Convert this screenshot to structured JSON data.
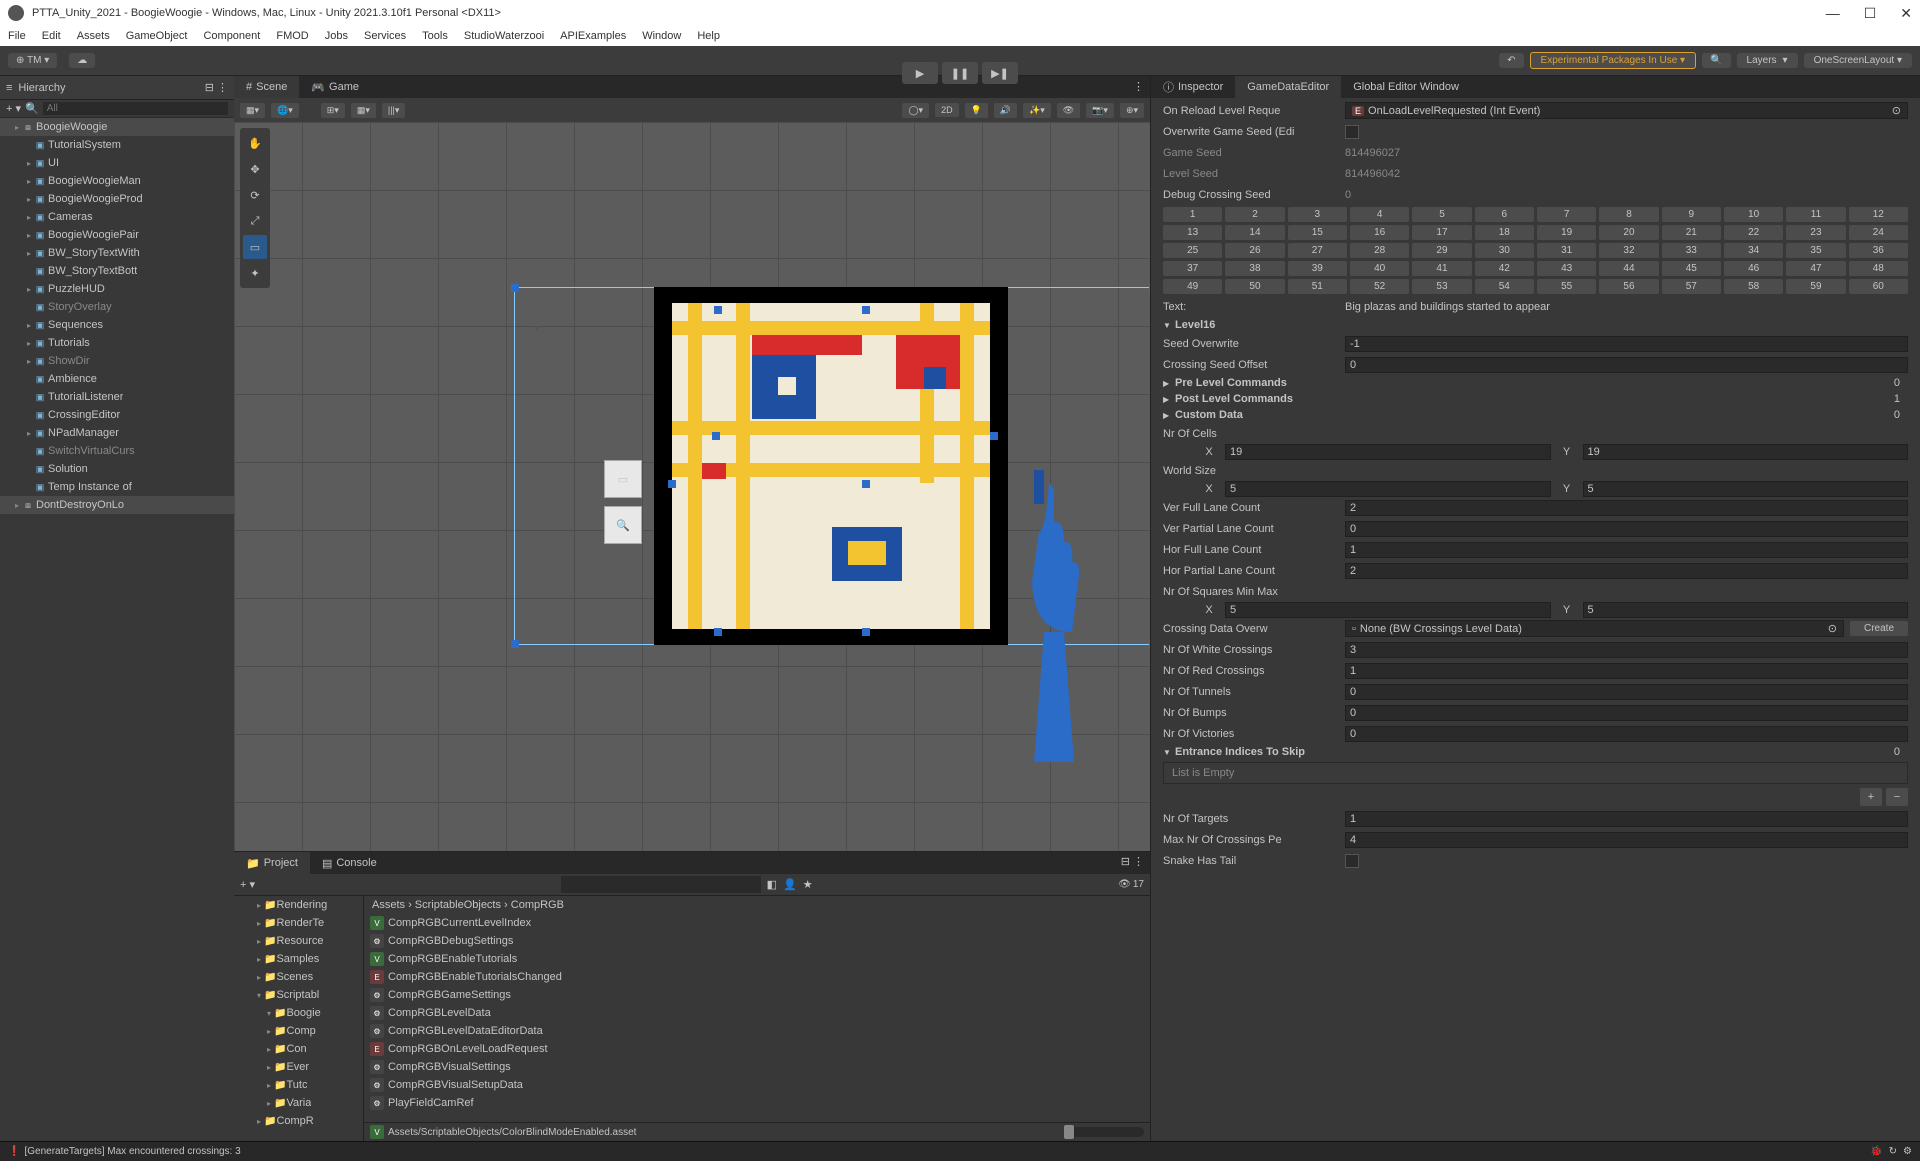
{
  "titlebar": "PTTA_Unity_2021 - BoogieWoogie - Windows, Mac, Linux - Unity 2021.3.10f1 Personal <DX11>",
  "menu": [
    "File",
    "Edit",
    "Assets",
    "GameObject",
    "Component",
    "FMOD",
    "Jobs",
    "Services",
    "Tools",
    "StudioWaterzooi",
    "APIExamples",
    "Window",
    "Help"
  ],
  "toolbar": {
    "tm": "TM ▾",
    "warn": "Experimental Packages In Use ▾",
    "layers": "Layers",
    "layout": "OneScreenLayout ▾"
  },
  "hierarchy": {
    "title": "Hierarchy",
    "search_ph": "All",
    "root": "BoogieWoogie",
    "items": [
      {
        "label": "TutorialSystem",
        "indent": 2,
        "dim": false
      },
      {
        "label": "UI",
        "indent": 2,
        "dim": false,
        "exp": true
      },
      {
        "label": "BoogieWoogieMan",
        "indent": 2,
        "dim": false,
        "exp": true
      },
      {
        "label": "BoogieWoogieProd",
        "indent": 2,
        "dim": false,
        "exp": true
      },
      {
        "label": "Cameras",
        "indent": 2,
        "dim": false,
        "exp": true
      },
      {
        "label": "BoogieWoogiePair",
        "indent": 2,
        "dim": false,
        "exp": true
      },
      {
        "label": "BW_StoryTextWith",
        "indent": 2,
        "dim": false,
        "exp": true
      },
      {
        "label": "BW_StoryTextBott",
        "indent": 2,
        "dim": false
      },
      {
        "label": "PuzzleHUD",
        "indent": 2,
        "dim": false,
        "exp": true
      },
      {
        "label": "StoryOverlay",
        "indent": 2,
        "dim": true
      },
      {
        "label": "Sequences",
        "indent": 2,
        "dim": false,
        "exp": true
      },
      {
        "label": "Tutorials",
        "indent": 2,
        "dim": false,
        "exp": true
      },
      {
        "label": "ShowDir",
        "indent": 2,
        "dim": true,
        "exp": true
      },
      {
        "label": "Ambience",
        "indent": 2,
        "dim": false
      },
      {
        "label": "TutorialListener",
        "indent": 2,
        "dim": false
      },
      {
        "label": "CrossingEditor",
        "indent": 2,
        "dim": false
      },
      {
        "label": "NPadManager",
        "indent": 2,
        "dim": false,
        "exp": true
      },
      {
        "label": "SwitchVirtualCurs",
        "indent": 2,
        "dim": true
      },
      {
        "label": "Solution",
        "indent": 2,
        "dim": false
      },
      {
        "label": "Temp Instance of",
        "indent": 2,
        "dim": false
      }
    ],
    "dontdestroy": "DontDestroyOnLo"
  },
  "scene": {
    "tab_scene": "Scene",
    "tab_game": "Game",
    "btn_2d": "2D"
  },
  "project": {
    "tab_project": "Project",
    "tab_console": "Console",
    "breadcrumb": "Assets  ›  ScriptableObjects  ›  CompRGB",
    "tree": [
      "Rendering",
      "RenderTe",
      "Resource",
      "Samples",
      "Scenes",
      "Scriptabl",
      "Boogie",
      "Comp",
      "Con",
      "Ever",
      "Tutc",
      "Varia",
      "CompR"
    ],
    "assets": [
      {
        "t": "v",
        "label": "CompRGBCurrentLevelIndex"
      },
      {
        "t": "s",
        "label": "CompRGBDebugSettings"
      },
      {
        "t": "v",
        "label": "CompRGBEnableTutorials"
      },
      {
        "t": "e",
        "label": "CompRGBEnableTutorialsChanged"
      },
      {
        "t": "s",
        "label": "CompRGBGameSettings"
      },
      {
        "t": "s",
        "label": "CompRGBLevelData"
      },
      {
        "t": "s",
        "label": "CompRGBLevelDataEditorData"
      },
      {
        "t": "e",
        "label": "CompRGBOnLevelLoadRequest"
      },
      {
        "t": "s",
        "label": "CompRGBVisualSettings"
      },
      {
        "t": "s",
        "label": "CompRGBVisualSetupData"
      },
      {
        "t": "s",
        "label": "PlayFieldCamRef"
      }
    ],
    "footer_icon": "V",
    "footer": "Assets/ScriptableObjects/ColorBlindModeEnabled.asset",
    "eye": "17"
  },
  "inspector": {
    "tabs": [
      "Inspector",
      "GameDataEditor",
      "Global Editor Window"
    ],
    "reload_label": "On Reload Level Reque",
    "reload_val": "OnLoadLevelRequested (Int Event)",
    "overwrite_seed_label": "Overwrite Game Seed (Edi",
    "game_seed_label": "Game Seed",
    "game_seed": "814496027",
    "level_seed_label": "Level Seed",
    "level_seed": "814496042",
    "debug_crossing_label": "Debug Crossing Seed",
    "debug_crossing": "0",
    "text_label": "Text:",
    "text_val": "Big plazas and buildings started to appear",
    "level16": "Level16",
    "seed_ow_label": "Seed Overwrite",
    "seed_ow": "-1",
    "cross_off_label": "Crossing Seed Offset",
    "cross_off": "0",
    "pre_level": "Pre Level Commands",
    "pre_level_n": "0",
    "post_level": "Post Level Commands",
    "post_level_n": "1",
    "custom_data": "Custom Data",
    "custom_data_n": "0",
    "cells_label": "Nr Of Cells",
    "cells_x": "19",
    "cells_y": "19",
    "world_label": "World Size",
    "world_x": "5",
    "world_y": "5",
    "vfull_label": "Ver Full Lane Count",
    "vfull": "2",
    "vpart_label": "Ver Partial Lane Count",
    "vpart": "0",
    "hfull_label": "Hor Full Lane Count",
    "hfull": "1",
    "hpart_label": "Hor Partial Lane Count",
    "hpart": "2",
    "sq_label": "Nr Of Squares Min Max",
    "sq_x": "5",
    "sq_y": "5",
    "cdata_label": "Crossing Data Overw",
    "cdata_val": "None (BW Crossings Level Data)",
    "create": "Create",
    "white_label": "Nr Of White Crossings",
    "white": "3",
    "red_label": "Nr Of Red Crossings",
    "red": "1",
    "tun_label": "Nr Of Tunnels",
    "tun": "0",
    "bump_label": "Nr Of Bumps",
    "bump": "0",
    "vic_label": "Nr Of Victories",
    "vic": "0",
    "ent_label": "Entrance Indices To Skip",
    "ent_n": "0",
    "list_empty": "List is Empty",
    "targ_label": "Nr Of Targets",
    "targ": "1",
    "maxc_label": "Max Nr Of Crossings Pe",
    "maxc": "4",
    "snake_label": "Snake Has Tail"
  },
  "status": {
    "msg": "[GenerateTargets] Max encountered crossings: 3"
  }
}
